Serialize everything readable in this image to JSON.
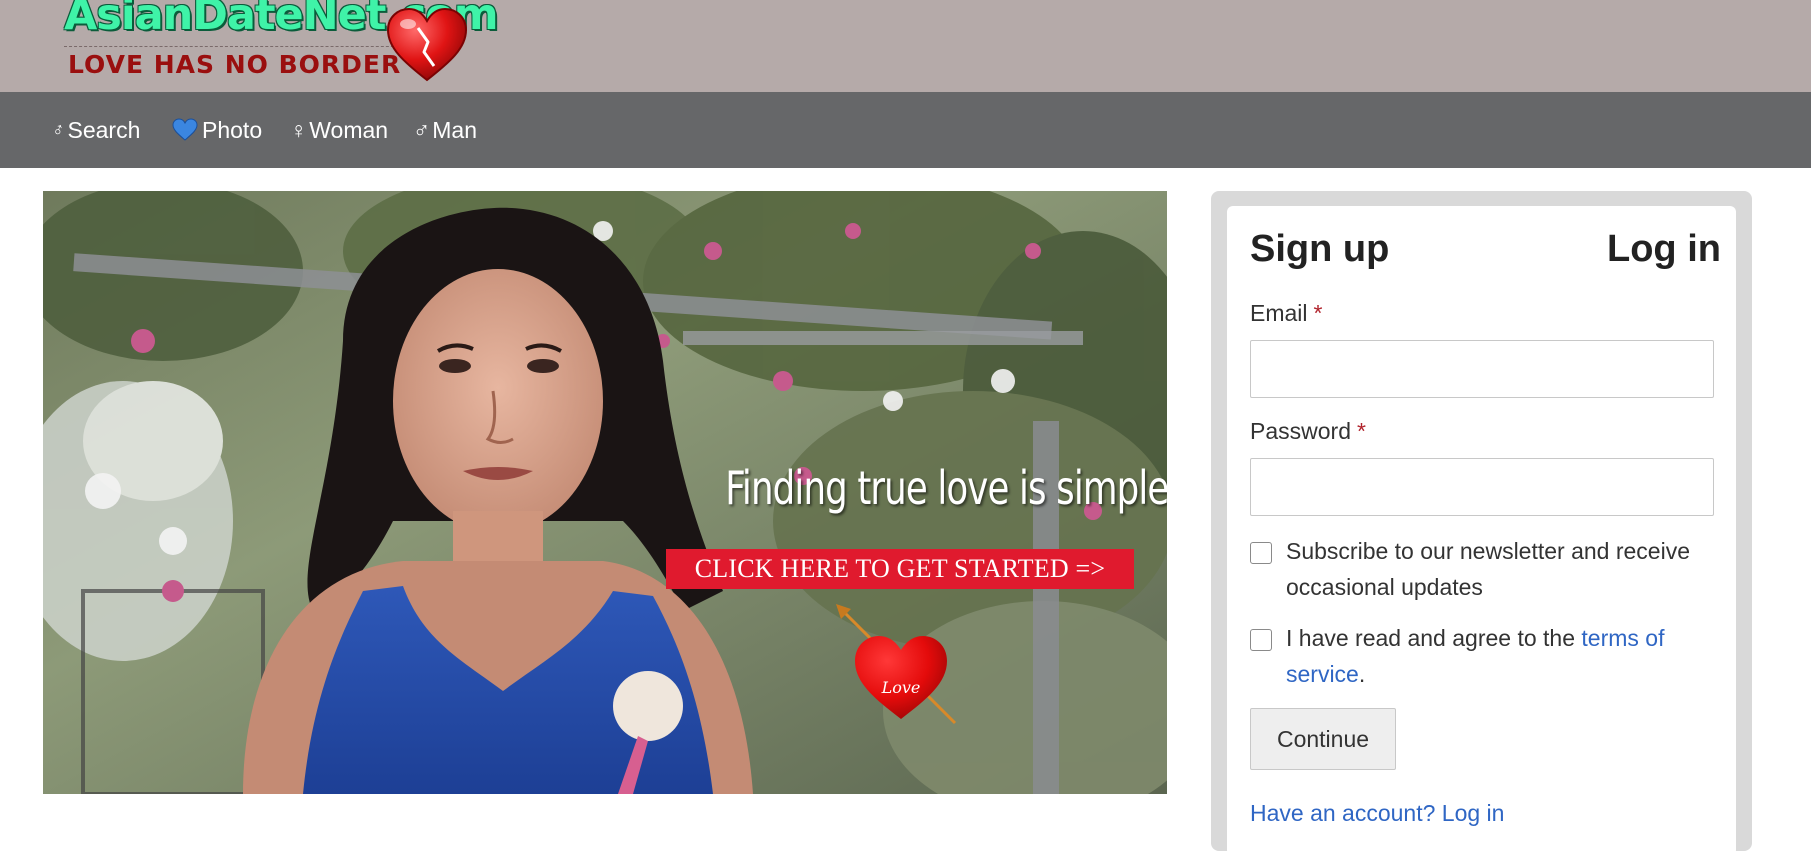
{
  "header": {
    "logo_title": "AsianDateNet.com",
    "logo_tagline": "LOVE HAS NO BORDER"
  },
  "nav": {
    "items": [
      {
        "icon": "♂",
        "label": "Search"
      },
      {
        "icon": "blue-heart-icon",
        "label": "Photo"
      },
      {
        "icon": "♀",
        "label": "Woman"
      },
      {
        "icon": "♂",
        "label": "Man"
      }
    ]
  },
  "hero": {
    "headline": "Finding true love is simple",
    "cta": "CLICK HERE TO GET STARTED =>",
    "heart_text": "Love"
  },
  "auth": {
    "tab_signup": "Sign up",
    "tab_login": "Log in",
    "email_label": "Email",
    "password_label": "Password",
    "required_mark": "*",
    "email_value": "",
    "password_value": "",
    "newsletter_text": "Subscribe to our newsletter and receive occasional updates",
    "terms_prefix": "I have read and agree to the ",
    "terms_link": "terms of service",
    "terms_suffix": ".",
    "continue_label": "Continue",
    "account_link": "Have an account? Log in"
  },
  "colors": {
    "header_bg": "#b5aaa9",
    "nav_bg": "#666769",
    "cta_red": "#e01a2e",
    "link_blue": "#2f66c4",
    "required_red": "#b1232c"
  }
}
